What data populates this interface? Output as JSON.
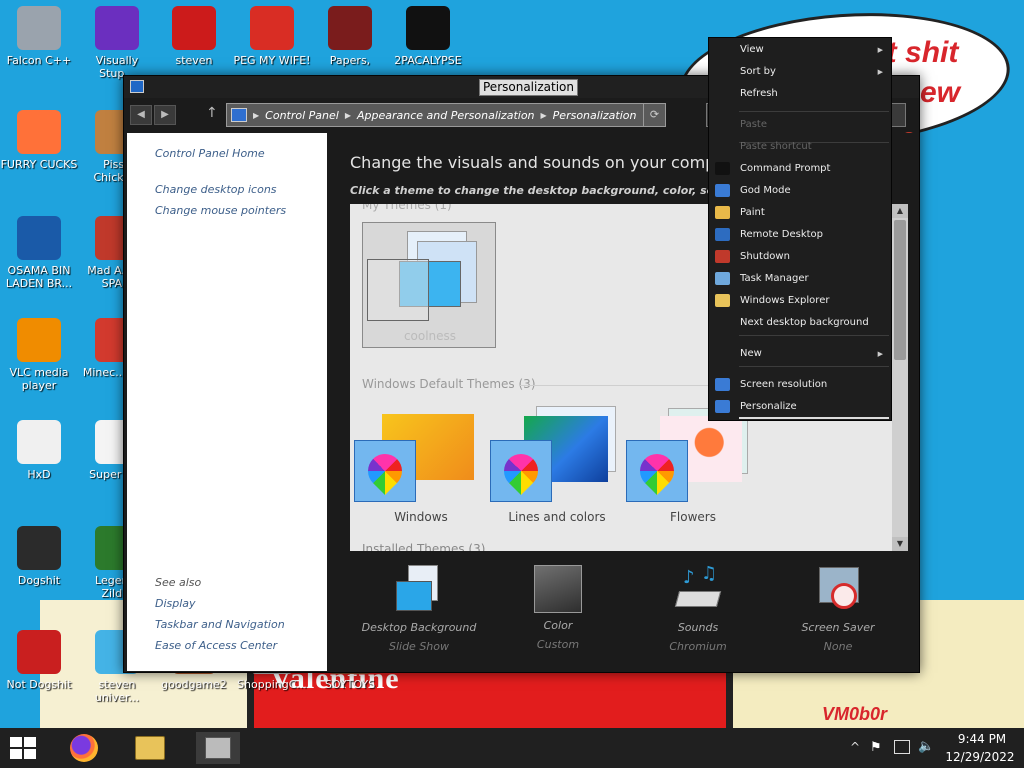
{
  "desktop": {
    "bubble_text": [
      "at shit",
      "ew"
    ],
    "cartoon_word": "Valentine",
    "signature": "VM0b0r",
    "icons": [
      {
        "label": "Falcon C++",
        "icon": "recycle-bin-icon",
        "color": "#9aa3ad"
      },
      {
        "label": "Visually Stup...",
        "icon": "visual-studio-icon",
        "color": "#6b2fbf"
      },
      {
        "label": "steven",
        "icon": "steven-icon",
        "color": "#cc1b1b"
      },
      {
        "label": "PEG MY WIFE!",
        "icon": "p-logo-icon",
        "color": "#d92d24"
      },
      {
        "label": "Papers,",
        "icon": "papers-icon",
        "color": "#7a1c1c"
      },
      {
        "label": "2PACALYPSE",
        "icon": "terminal-icon",
        "color": "#111111"
      },
      {
        "label": "FURRY CUCKS",
        "icon": "firefox-icon",
        "color": "#ff7139"
      },
      {
        "label": "Pisso Chicke...",
        "icon": "game-icon",
        "color": "#c08040"
      },
      {
        "label": "OSAMA BIN LADEN BR...",
        "icon": "obama-logo-icon",
        "color": "#1a5aa8"
      },
      {
        "label": "Mad A... IN SPA...",
        "icon": "angry-birds-icon",
        "color": "#c0392b"
      },
      {
        "label": "VLC media player",
        "icon": "vlc-icon",
        "color": "#f08c00"
      },
      {
        "label": "Minec... Bird",
        "icon": "angry-bird-icon",
        "color": "#d23a2e"
      },
      {
        "label": "HxD",
        "icon": "hxd-icon",
        "color": "#f0f0f0"
      },
      {
        "label": "Super M...",
        "icon": "mario-icon",
        "color": "#f4f4f4"
      },
      {
        "label": "Dogshit",
        "icon": "falcon-icon",
        "color": "#2b2b2b"
      },
      {
        "label": "Legen... Zild...",
        "icon": "zelda-icon",
        "color": "#2c7a2c"
      },
      {
        "label": "Not Dogshit",
        "icon": "devcpp-icon",
        "color": "#c91f1f"
      },
      {
        "label": "steven univer...",
        "icon": "gem-icon",
        "color": "#44b3e6"
      },
      {
        "label": "goodgame2",
        "icon": "goodgame-icon",
        "color": "#b05a2a"
      },
      {
        "label": "ShoppingC...",
        "icon": "cart-icon",
        "color": "#c0c0c0"
      },
      {
        "label": "SOYTOYS",
        "icon": "soytoys-icon",
        "color": "#8b4a2a"
      }
    ]
  },
  "window": {
    "title": "Personalization",
    "address": {
      "crumbs": [
        "Control Panel",
        "Appearance and Personalization",
        "Personalization"
      ]
    },
    "left_links": [
      "Control Panel Home",
      "Change desktop icons",
      "Change mouse pointers"
    ],
    "see_also_title": "See also",
    "see_also": [
      "Display",
      "Taskbar and Navigation",
      "Ease of Access Center"
    ],
    "heading": "Change the visuals and sounds on your computer",
    "subheading": "Click a theme to change the desktop background, color, sounds, and screen saver all at once.",
    "groups": {
      "my_themes": "My Themes (1)",
      "default_themes": "Windows Default Themes (3)",
      "installed_themes": "Installed Themes (3)"
    },
    "my_theme_name": "coolness",
    "default_themes": [
      "Windows",
      "Lines and colors",
      "Flowers"
    ],
    "bottom": [
      {
        "label": "Desktop Background",
        "value": "Slide Show"
      },
      {
        "label": "Color",
        "value": "Custom"
      },
      {
        "label": "Sounds",
        "value": "Chromium"
      },
      {
        "label": "Screen Saver",
        "value": "None"
      }
    ]
  },
  "context_menu": {
    "items": [
      {
        "label": "View",
        "arrow": true
      },
      {
        "label": "Sort by",
        "arrow": true
      },
      {
        "label": "Refresh"
      },
      {
        "label": "Paste",
        "disabled": true
      },
      {
        "label": "Paste shortcut",
        "disabled": true
      },
      {
        "label": "Command Prompt",
        "icon": "terminal-icon",
        "color": "#111111"
      },
      {
        "label": "God Mode",
        "icon": "control-panel-icon",
        "color": "#3a7bd5"
      },
      {
        "label": "Paint",
        "icon": "paint-icon",
        "color": "#e9b949"
      },
      {
        "label": "Remote Desktop",
        "icon": "remote-desktop-icon",
        "color": "#2d6cc0"
      },
      {
        "label": "Shutdown",
        "icon": "shield-icon",
        "color": "#c0392b"
      },
      {
        "label": "Task Manager",
        "icon": "task-manager-icon",
        "color": "#6fa8dc"
      },
      {
        "label": "Windows Explorer",
        "icon": "folder-icon",
        "color": "#e8c35a"
      },
      {
        "label": "Next desktop background"
      },
      {
        "label": "New",
        "arrow": true
      },
      {
        "label": "Screen resolution",
        "icon": "display-icon",
        "color": "#3a7bd5"
      },
      {
        "label": "Personalize",
        "icon": "personalize-icon",
        "color": "#3a7bd5"
      }
    ]
  },
  "taskbar": {
    "time": "9:44 PM",
    "date": "12/29/2022",
    "tray": "^"
  }
}
